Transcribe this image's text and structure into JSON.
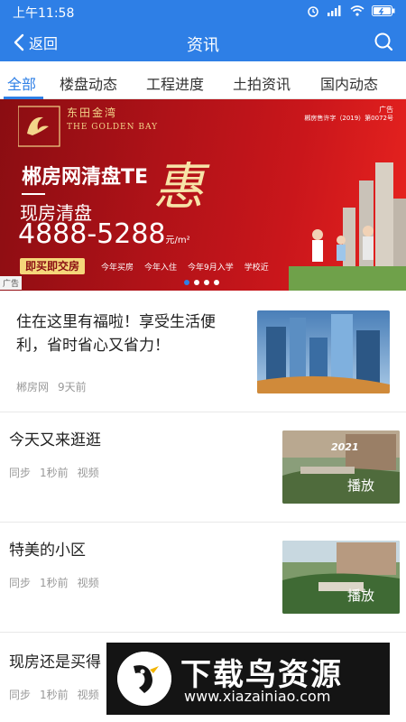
{
  "status_bar": {
    "time": "上午11:58",
    "icons": [
      "alarm-icon",
      "signal-icon",
      "wifi-icon",
      "battery-icon"
    ]
  },
  "nav": {
    "back_label": "返回",
    "title": "资讯",
    "search_icon": "search-icon"
  },
  "tabs": [
    {
      "label": "全部",
      "active": true
    },
    {
      "label": "楼盘动态",
      "active": false
    },
    {
      "label": "工程进度",
      "active": false
    },
    {
      "label": "土拍资讯",
      "active": false
    },
    {
      "label": "国内动态",
      "active": false
    }
  ],
  "banner": {
    "logo_cn": "东田金湾",
    "logo_en": "THE GOLDEN BAY",
    "ad_tag": "广告",
    "permit": "郴房售许字（2019）第0072号",
    "headline": "郴房网清盘TE",
    "headline_accent": "惠",
    "subtitle": "现房清盘",
    "phone": "4888-5288",
    "price_unit": "元/m²",
    "button": "即买即交房",
    "features": [
      "今年买房",
      "今年入住",
      "今年9月入学",
      "学校近"
    ],
    "ad_corner": "广告",
    "slides": 4,
    "active_slide": 0
  },
  "articles": [
    {
      "title": "住在这里有福啦！享受生活便利，省时省心又省力！",
      "source": "郴房网",
      "time": "9天前",
      "type": ""
    },
    {
      "title": "今天又来逛逛",
      "source": "同步",
      "time": "1秒前",
      "type": "视频",
      "thumb_label": "播放",
      "thumb_year": "2021"
    },
    {
      "title": "特美的小区",
      "source": "同步",
      "time": "1秒前",
      "type": "视频",
      "thumb_label": "播放"
    },
    {
      "title": "现房还是买得",
      "source": "同步",
      "time": "1秒前",
      "type": "视频"
    }
  ],
  "watermark": {
    "cn": "下载鸟资源",
    "url": "www.xiazainiao.com"
  },
  "colors": {
    "primary": "#2e7fe6",
    "banner_red": "#b01218",
    "gold": "#f3d58a"
  }
}
